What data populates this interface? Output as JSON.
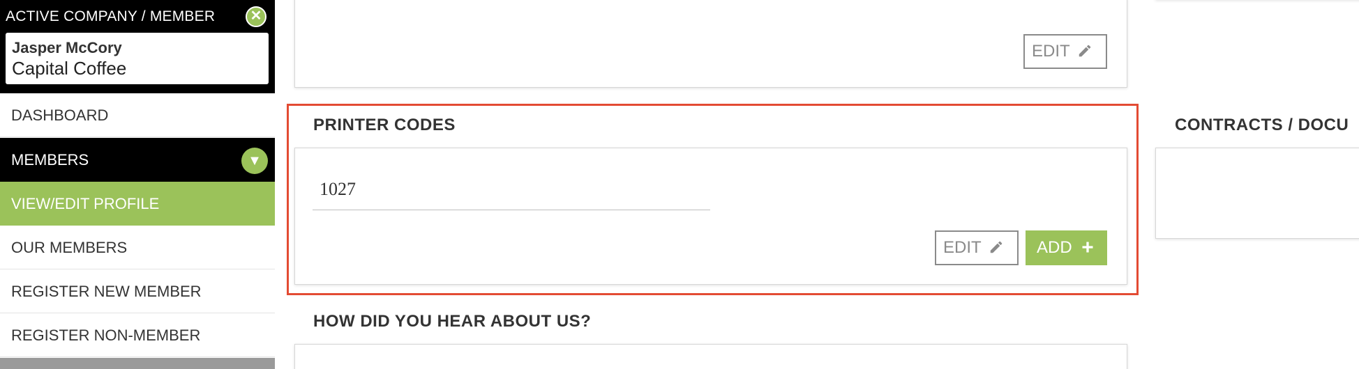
{
  "sidebar": {
    "active_title": "ACTIVE COMPANY / MEMBER",
    "close_glyph": "✕",
    "member_name": "Jasper McCory",
    "member_company": "Capital Coffee",
    "items": [
      {
        "label": "DASHBOARD"
      },
      {
        "label": "MEMBERS"
      },
      {
        "label": "VIEW/EDIT PROFILE"
      },
      {
        "label": "OUR MEMBERS"
      },
      {
        "label": "REGISTER NEW MEMBER"
      },
      {
        "label": "REGISTER NON-MEMBER"
      }
    ],
    "members_chevron_glyph": "▼"
  },
  "main": {
    "top_panel": {
      "edit_label": "EDIT"
    },
    "printer_codes": {
      "title": "PRINTER CODES",
      "code_value": "1027",
      "edit_label": "EDIT",
      "add_label": "ADD"
    },
    "hear_about": {
      "title": "HOW DID YOU HEAR ABOUT US?"
    },
    "contracts": {
      "title": "CONTRACTS / DOCU"
    }
  },
  "colors": {
    "accent_green": "#9bc25a",
    "highlight_red": "#e34b33",
    "sidebar_black": "#000000"
  },
  "icons": {
    "edit": "pencil-icon",
    "add": "plus-icon",
    "close": "close-icon",
    "chevron": "chevron-down-icon"
  }
}
